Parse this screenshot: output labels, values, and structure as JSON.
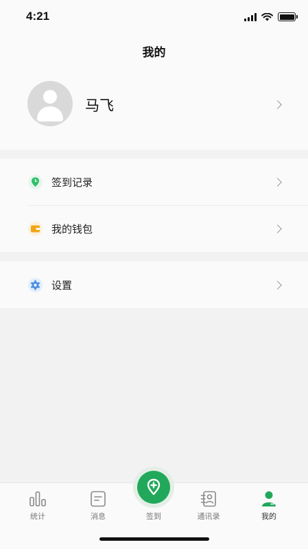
{
  "status_bar": {
    "time": "4:21"
  },
  "header": {
    "title": "我的"
  },
  "profile": {
    "name": "马飞"
  },
  "menu_group_1": [
    {
      "label": "签到记录",
      "icon": "clock-icon",
      "color": "#2fbf6b"
    },
    {
      "label": "我的钱包",
      "icon": "wallet-icon",
      "color": "#f2a516"
    }
  ],
  "menu_group_2": [
    {
      "label": "设置",
      "icon": "gear-icon",
      "color": "#4a90e2"
    }
  ],
  "tabbar": {
    "items": [
      {
        "label": "统计",
        "icon": "bar-chart-icon"
      },
      {
        "label": "消息",
        "icon": "message-icon"
      },
      {
        "label": "签到",
        "icon": "location-plus-icon"
      },
      {
        "label": "通讯录",
        "icon": "contacts-icon"
      },
      {
        "label": "我的",
        "icon": "person-icon"
      }
    ],
    "active_index": 4,
    "accent": "#22a85a"
  }
}
